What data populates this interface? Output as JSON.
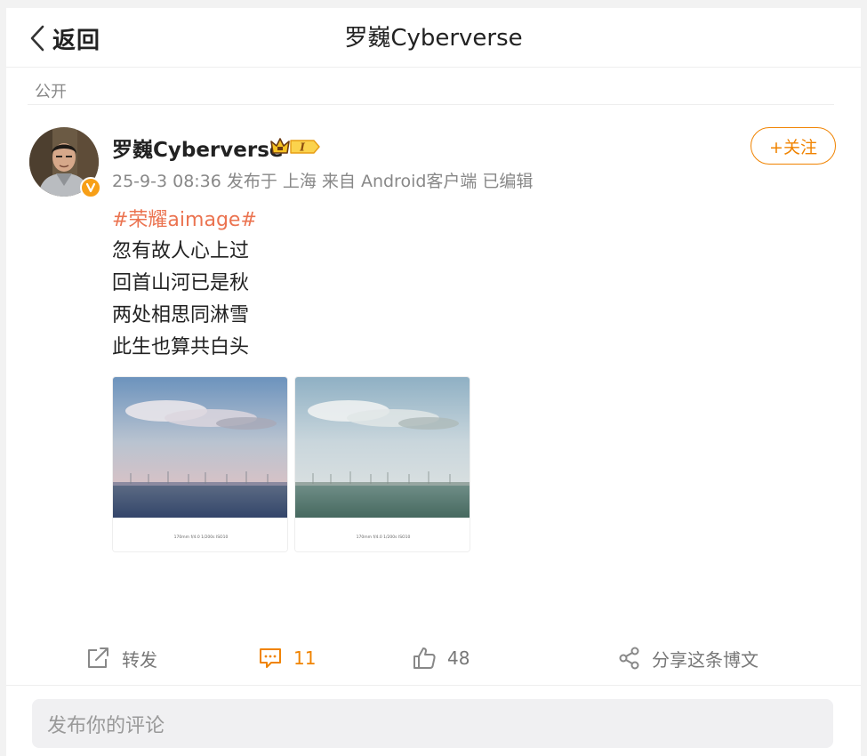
{
  "header": {
    "back_label": "返回",
    "title": "罗巍Cyberverse"
  },
  "visibility": "公开",
  "post": {
    "author": "罗巍Cyberverse",
    "vip_badge": "I",
    "date": "25-9-3 08:36",
    "location": "发布于 上海",
    "source": "来自 Android客户端",
    "edited": "已编辑",
    "follow_label": "+关注",
    "topic": "#荣耀aimage#",
    "lines": [
      "忽有故人心上过",
      "回首山河已是秋",
      "两处相思同淋雪",
      "此生也算共白头"
    ],
    "images": [
      {
        "caption": "170mm f/4.0 1/200s ISO10",
        "tint": "warm"
      },
      {
        "caption": "170mm f/4.0 1/200s ISO10",
        "tint": "cool"
      }
    ]
  },
  "actions": {
    "repost_label": "转发",
    "comment_count": "11",
    "like_count": "48",
    "share_label": "分享这条博文"
  },
  "comment_input": {
    "placeholder": "发布你的评论"
  },
  "colors": {
    "accent": "#f08300",
    "topic": "#eb7350",
    "verified": "#f79f17"
  }
}
